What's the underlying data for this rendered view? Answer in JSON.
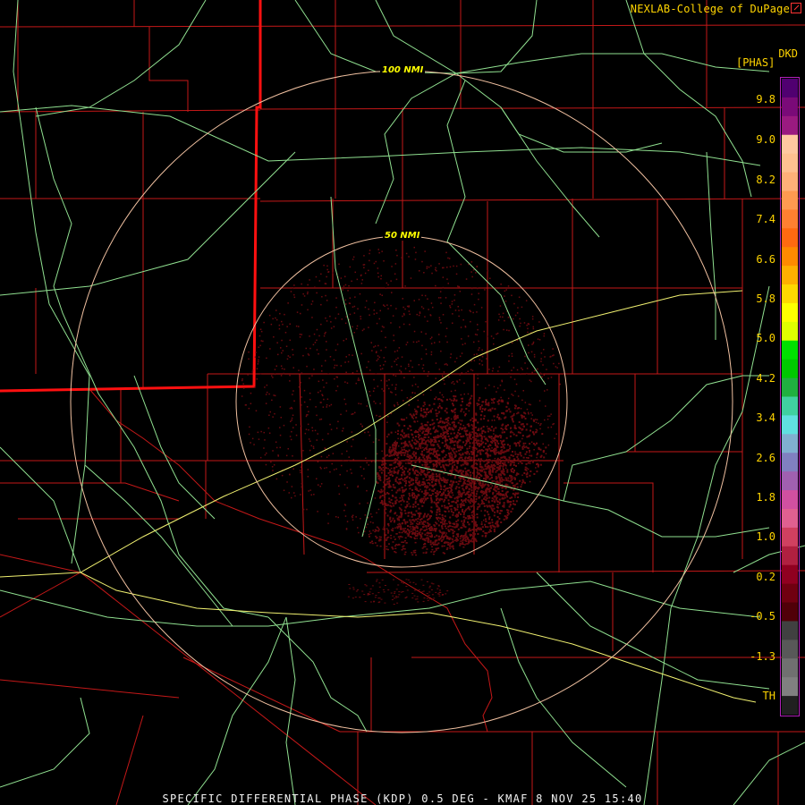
{
  "credit": "NEXLAB-College of DuPage",
  "product_code": "DKD",
  "unit": "[PHAS]",
  "footer": "SPECIFIC DIFFERENTIAL PHASE (KDP) 0.5 DEG - KMAF 8 NOV 25 15:40",
  "range_rings": [
    {
      "label": "50 NMI"
    },
    {
      "label": "100 NMI"
    }
  ],
  "scale_labels": [
    "9.8",
    "9.0",
    "8.2",
    "7.4",
    "6.6",
    "5.8",
    "5.0",
    "4.2",
    "3.4",
    "2.6",
    "1.8",
    "1.0",
    "0.2",
    "-0.5",
    "-1.3",
    "TH"
  ],
  "scale_colors": [
    "#500070",
    "#7a0a78",
    "#9a1a80",
    "#ffc8a0",
    "#ffc090",
    "#ffb078",
    "#ff9a50",
    "#ff8030",
    "#ff6a10",
    "#ff8a00",
    "#ffb000",
    "#ffd800",
    "#ffff00",
    "#e0ff00",
    "#00e000",
    "#00c800",
    "#20b040",
    "#40d0a0",
    "#60e0e0",
    "#80b0d0",
    "#8080c0",
    "#a060b0",
    "#d050a0",
    "#e06090",
    "#d04060",
    "#b02040",
    "#900020",
    "#700010",
    "#500008",
    "#404040",
    "#585858",
    "#707070",
    "#808080",
    "#202020"
  ],
  "colors": {
    "roads": "#90e090",
    "interstates": "#f0f070",
    "counties": "#c41818",
    "state_line": "#ff1010",
    "rings": "#f0c0a0",
    "echo": "#6a0a10"
  }
}
